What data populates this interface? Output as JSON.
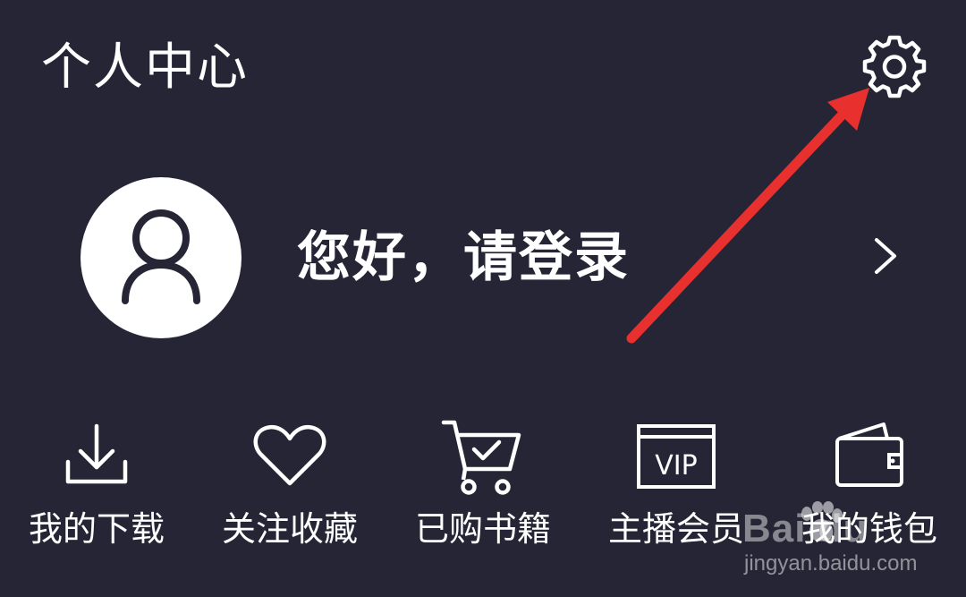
{
  "header": {
    "title": "个人中心",
    "settings_icon": "gear-icon"
  },
  "profile": {
    "avatar_icon": "user-icon",
    "login_prompt": "您好，请登录",
    "chevron_icon": "chevron-right-icon"
  },
  "shortcuts": [
    {
      "label": "我的下载",
      "icon": "download-icon"
    },
    {
      "label": "关注收藏",
      "icon": "heart-icon"
    },
    {
      "label": "已购书籍",
      "icon": "shopping-cart-icon"
    },
    {
      "label": "主播会员",
      "icon": "vip-card-icon"
    },
    {
      "label": "我的钱包",
      "icon": "wallet-icon"
    }
  ],
  "vip_icon_text": "VIP",
  "watermark": {
    "logo_text": "Bai du",
    "url": "jingyan.baidu.com"
  },
  "colors": {
    "background": "#262535",
    "foreground": "#ffffff",
    "annotation_arrow": "#e8312f"
  }
}
